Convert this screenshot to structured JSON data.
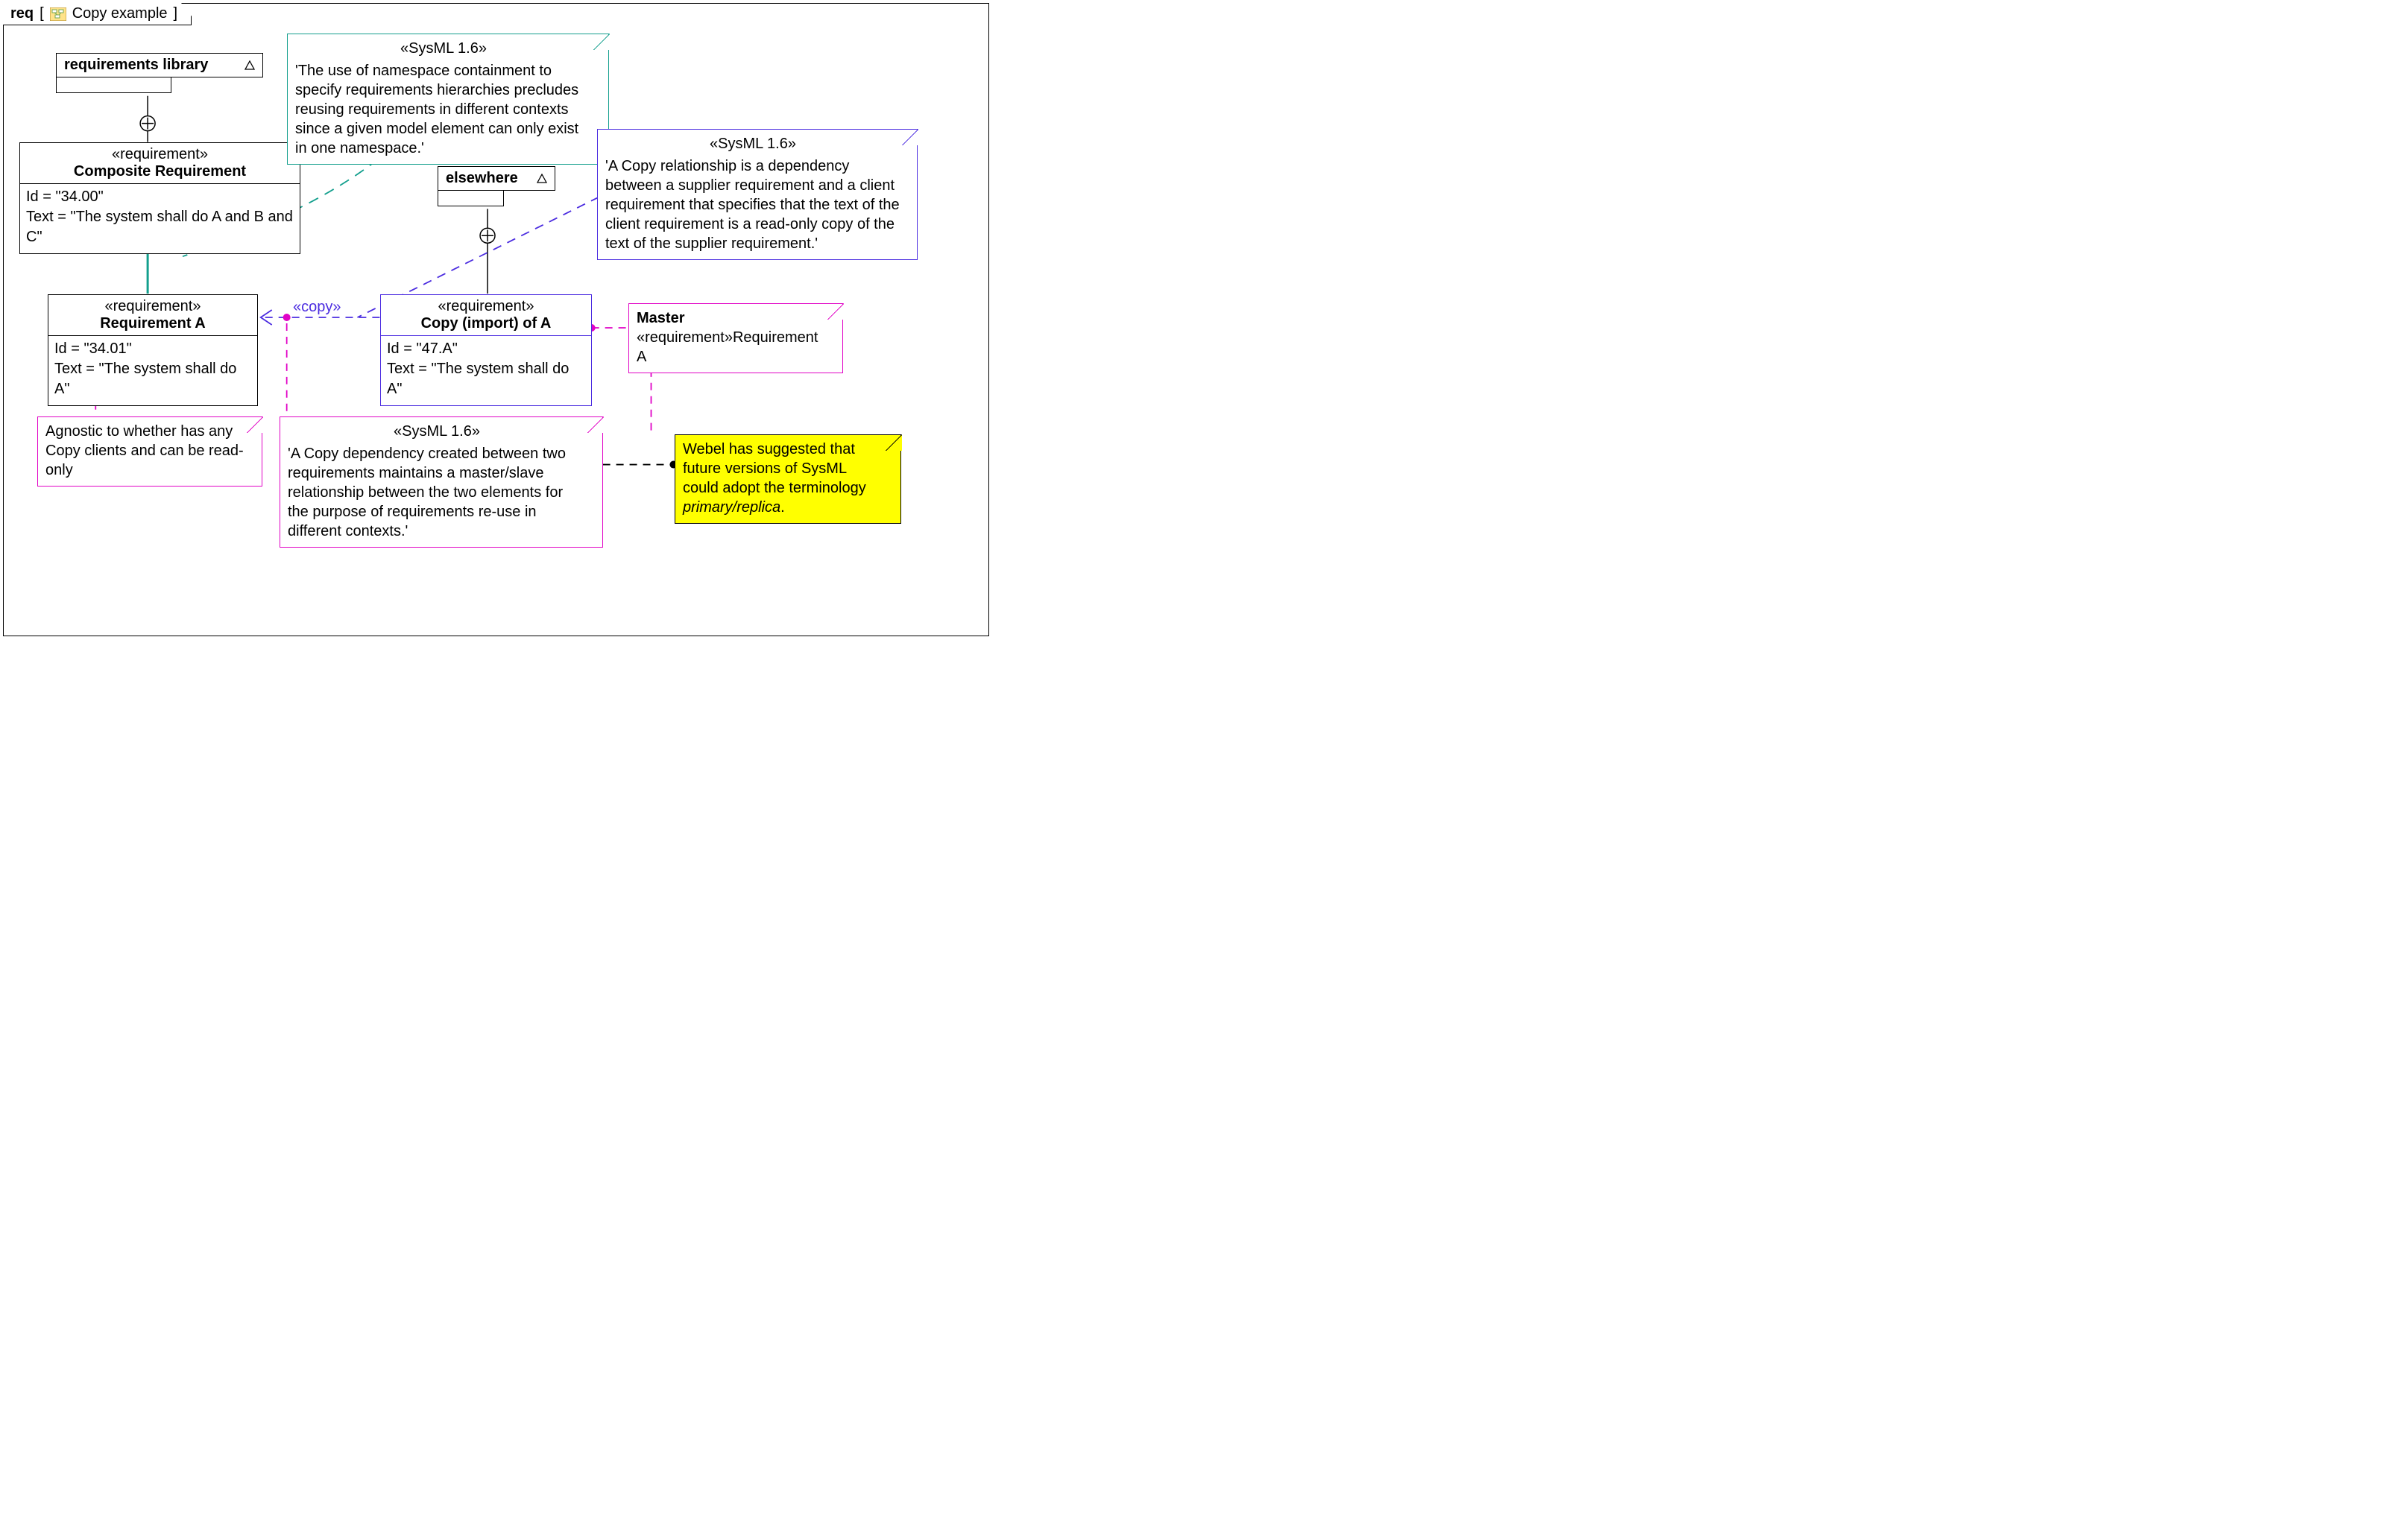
{
  "frame": {
    "kind": "req",
    "title": "Copy example"
  },
  "packages": {
    "lib": {
      "name": "requirements library"
    },
    "elsewhere": {
      "name": "elsewhere"
    }
  },
  "reqs": {
    "composite": {
      "stereo": "«requirement»",
      "name": "Composite Requirement",
      "id": "Id = \"34.00\"",
      "text": "Text = \"The system shall do A and B and C\""
    },
    "reqA": {
      "stereo": "«requirement»",
      "name": "Requirement A",
      "id": "Id = \"34.01\"",
      "text": "Text = \"The system shall do A\""
    },
    "copyA": {
      "stereo": "«requirement»",
      "name": "Copy (import) of A",
      "id": "Id = \"47.A\"",
      "text": "Text = \"The system shall do A\""
    }
  },
  "rel": {
    "copy_label": "«copy»"
  },
  "notes": {
    "namespace": {
      "stereo": "«SysML 1.6»",
      "body": "'The use of namespace containment to specify requirements hierarchies precludes reusing requirements in different contexts since a given model element can only exist in one namespace.'"
    },
    "copydef": {
      "stereo": "«SysML 1.6»",
      "body": "'A Copy relationship is a dependency between a supplier requirement and a client requirement that specifies that the text of the client requirement is a read-only copy of the text of the supplier requirement.'"
    },
    "masterslave": {
      "stereo": "«SysML 1.6»",
      "body": "'A Copy dependency created between two requirements maintains a master/slave relationship between the two elements for the purpose of requirements re-use in different contexts.'"
    },
    "agnostic": {
      "body": "Agnostic to whether has any Copy clients and can be read-only"
    },
    "master": {
      "title": "Master",
      "line2a": "«requirement»",
      "line2b": "Requirement A"
    },
    "webel": {
      "body_pre": "Webel has suggested that future versions of SysML could adopt the terminology ",
      "body_it": "primary/replica",
      "body_post": "."
    }
  }
}
